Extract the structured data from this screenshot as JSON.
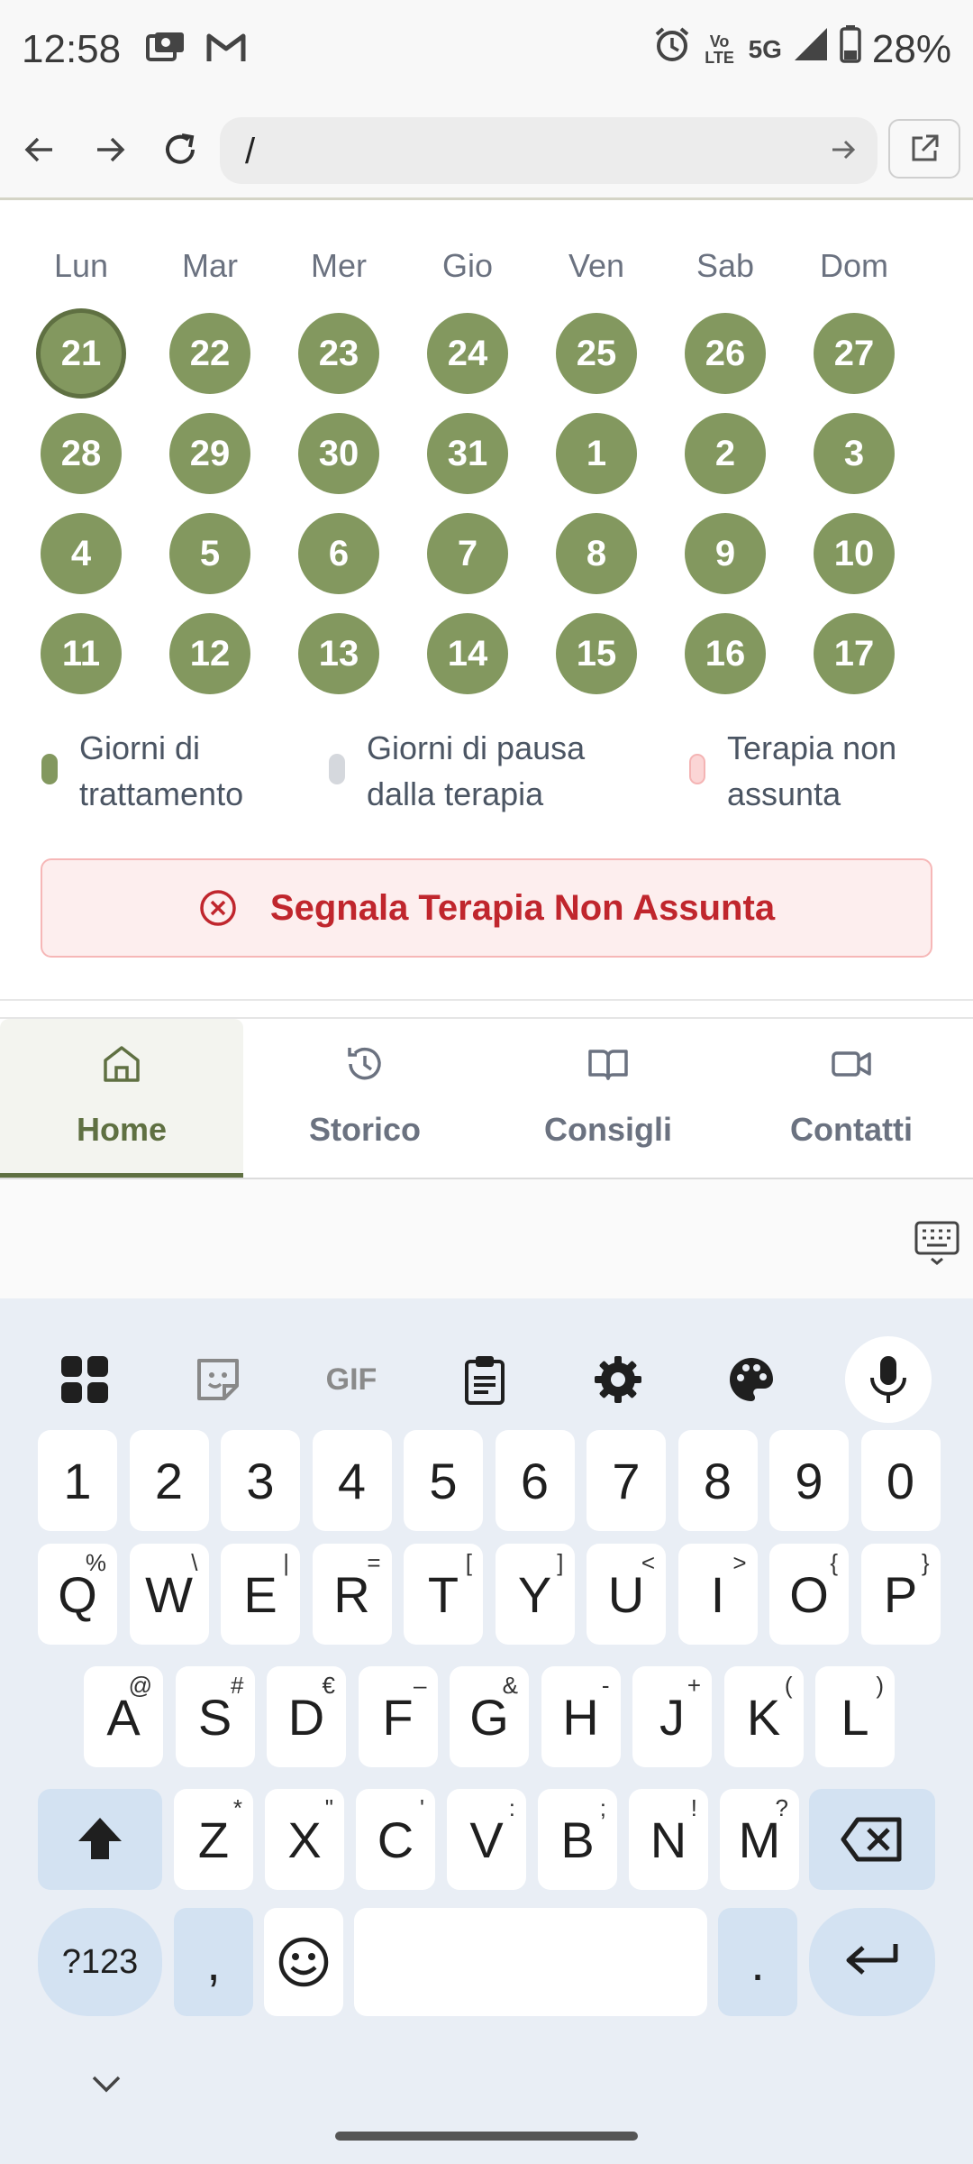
{
  "status_bar": {
    "time": "12:58",
    "notification_icons": [
      "photo-card-icon",
      "gmail-icon"
    ],
    "system_icons": [
      "alarm-icon",
      "volte-icon",
      "5g-icon",
      "signal-icon",
      "battery-icon"
    ],
    "volte_label": "Vo LTE",
    "network": "5G",
    "battery": "28%"
  },
  "browser": {
    "back_icon": "arrow-left-icon",
    "forward_icon": "arrow-right-icon",
    "reload_icon": "reload-icon",
    "url": "/",
    "go_icon": "arrow-right-icon",
    "open_external_icon": "open-external-icon"
  },
  "calendar": {
    "weekdays": [
      "Lun",
      "Mar",
      "Mer",
      "Gio",
      "Ven",
      "Sab",
      "Dom"
    ],
    "weeks": [
      [
        "21",
        "22",
        "23",
        "24",
        "25",
        "26",
        "27"
      ],
      [
        "28",
        "29",
        "30",
        "31",
        "1",
        "2",
        "3"
      ],
      [
        "4",
        "5",
        "6",
        "7",
        "8",
        "9",
        "10"
      ],
      [
        "11",
        "12",
        "13",
        "14",
        "15",
        "16",
        "17"
      ]
    ],
    "today": "21",
    "colors": {
      "treatment": "#83985f",
      "today_ring": "#5f7042"
    }
  },
  "legend": {
    "treatment": {
      "line1": "Giorni di",
      "line2": "trattamento",
      "color": "#83985f"
    },
    "pause": {
      "line1": "Giorni di pausa",
      "line2": "dalla terapia",
      "color": "#d5d8dd"
    },
    "missed": {
      "line1": "Terapia non",
      "line2": "assunta",
      "color": "#fbd5d5"
    }
  },
  "report_button": {
    "icon": "x-circle-icon",
    "label": "Segnala Terapia Non Assunta",
    "color": "#c0262d"
  },
  "tabs": [
    {
      "id": "home",
      "label": "Home",
      "icon": "home-icon",
      "active": true
    },
    {
      "id": "storico",
      "label": "Storico",
      "icon": "history-icon",
      "active": false
    },
    {
      "id": "consigli",
      "label": "Consigli",
      "icon": "book-icon",
      "active": false
    },
    {
      "id": "contatti",
      "label": "Contatti",
      "icon": "video-icon",
      "active": false
    }
  ],
  "keyboard": {
    "toolbar": [
      "apps-grid-icon",
      "sticker-icon",
      "gif-icon",
      "clipboard-icon",
      "settings-icon",
      "palette-icon",
      "mic-icon"
    ],
    "gif_label": "GIF",
    "numbers": [
      "1",
      "2",
      "3",
      "4",
      "5",
      "6",
      "7",
      "8",
      "9",
      "0"
    ],
    "row1": [
      {
        "key": "Q",
        "hint": "%"
      },
      {
        "key": "W",
        "hint": "\\"
      },
      {
        "key": "E",
        "hint": "|"
      },
      {
        "key": "R",
        "hint": "="
      },
      {
        "key": "T",
        "hint": "["
      },
      {
        "key": "Y",
        "hint": "]"
      },
      {
        "key": "U",
        "hint": "<"
      },
      {
        "key": "I",
        "hint": ">"
      },
      {
        "key": "O",
        "hint": "{"
      },
      {
        "key": "P",
        "hint": "}"
      }
    ],
    "row2": [
      {
        "key": "A",
        "hint": "@"
      },
      {
        "key": "S",
        "hint": "#"
      },
      {
        "key": "D",
        "hint": "€"
      },
      {
        "key": "F",
        "hint": "–"
      },
      {
        "key": "G",
        "hint": "&"
      },
      {
        "key": "H",
        "hint": "-"
      },
      {
        "key": "J",
        "hint": "+"
      },
      {
        "key": "K",
        "hint": "("
      },
      {
        "key": "L",
        "hint": ")"
      }
    ],
    "row3": [
      {
        "key": "Z",
        "hint": "*"
      },
      {
        "key": "X",
        "hint": "\""
      },
      {
        "key": "C",
        "hint": "'"
      },
      {
        "key": "V",
        "hint": ":"
      },
      {
        "key": "B",
        "hint": ";"
      },
      {
        "key": "N",
        "hint": "!"
      },
      {
        "key": "M",
        "hint": "?"
      }
    ],
    "shift_icon": "shift-icon",
    "backspace_icon": "backspace-icon",
    "symbols_label": "?123",
    "comma": ",",
    "emoji_icon": "emoji-icon",
    "period": ".",
    "enter_icon": "enter-icon",
    "collapse_icon": "chevron-down-icon",
    "toggle_icon": "keyboard-icon"
  }
}
